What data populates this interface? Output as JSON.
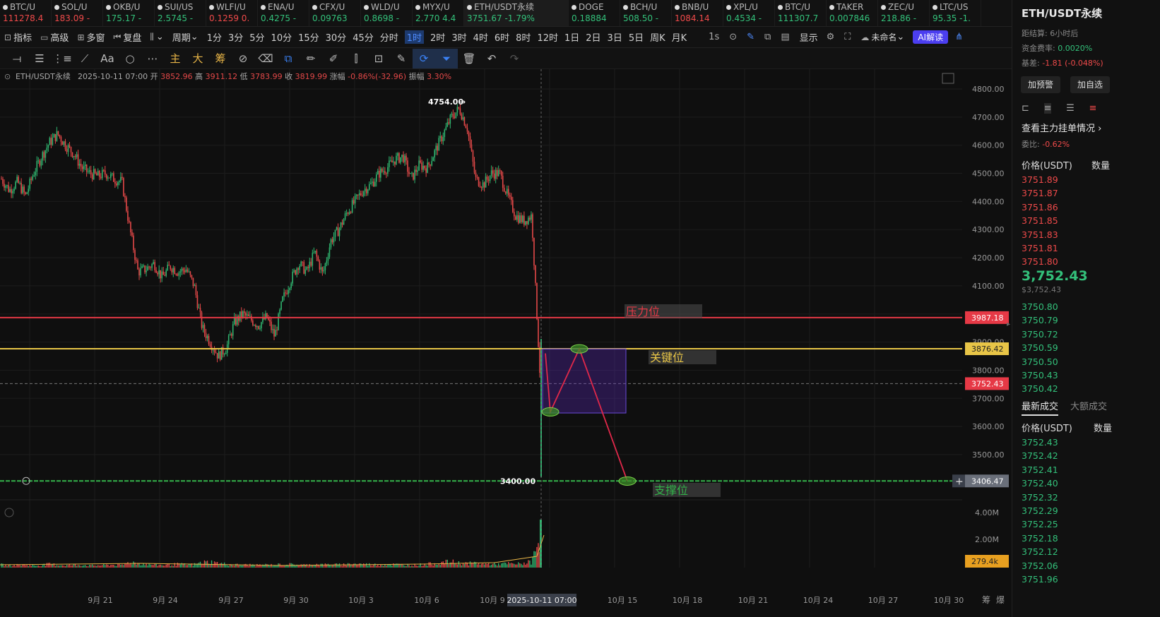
{
  "tickers": [
    {
      "sym": "BTC/U",
      "price": "111278.4",
      "dir": "down"
    },
    {
      "sym": "SOL/U",
      "price": "183.09 -",
      "dir": "down"
    },
    {
      "sym": "OKB/U",
      "price": "175.17 -",
      "dir": "up"
    },
    {
      "sym": "SUI/US",
      "price": "2.5745 -",
      "dir": "up"
    },
    {
      "sym": "WLFI/U",
      "price": "0.1259 0.",
      "dir": "down"
    },
    {
      "sym": "ENA/U",
      "price": "0.4275 -",
      "dir": "up"
    },
    {
      "sym": "CFX/U",
      "price": "0.09763",
      "dir": "up"
    },
    {
      "sym": "WLD/U",
      "price": "0.8698 -",
      "dir": "up"
    },
    {
      "sym": "MYX/U",
      "price": "2.770 4.4",
      "dir": "up"
    },
    {
      "sym": "ETH/USDT永续",
      "price": "3751.67 -1.79%",
      "dir": "up",
      "active": true
    },
    {
      "sym": "DOGE",
      "price": "0.18884",
      "dir": "up"
    },
    {
      "sym": "BCH/U",
      "price": "508.50 -",
      "dir": "up"
    },
    {
      "sym": "BNB/U",
      "price": "1084.14",
      "dir": "down"
    },
    {
      "sym": "XPL/U",
      "price": "0.4534 -",
      "dir": "up"
    },
    {
      "sym": "BTC/U",
      "price": "111307.7",
      "dir": "up"
    },
    {
      "sym": "TAKER",
      "price": "0.007846",
      "dir": "up"
    },
    {
      "sym": "ZEC/U",
      "price": "218.86 -",
      "dir": "up"
    },
    {
      "sym": "LTC/US",
      "price": "95.35 -1.",
      "dir": "up"
    }
  ],
  "ticker_add": "+",
  "menu": {
    "indicators": "指标",
    "advanced": "高级",
    "multi": "多窗",
    "replay": "复盘",
    "period": "周期",
    "timeframes": [
      "1分",
      "3分",
      "5分",
      "10分",
      "15分",
      "30分",
      "45分",
      "分时",
      "1时",
      "2时",
      "3时",
      "4时",
      "6时",
      "8时",
      "12时",
      "1日",
      "2日",
      "3日",
      "5日",
      "周K",
      "月K"
    ],
    "selected_tf": "1时",
    "sec": "1s",
    "display": "显示",
    "unnamed": "未命名",
    "ai": "AI解读"
  },
  "drawbar": {
    "text_tool": "Aa",
    "label_main": "主",
    "label_big": "大",
    "label_chip": "筹"
  },
  "legend": {
    "symbol": "ETH/USDT永续",
    "date": "2025-10-11 07:00",
    "open_l": "开",
    "open": "3852.96",
    "high_l": "高",
    "high": "3911.12",
    "low_l": "低",
    "low": "3783.99",
    "close_l": "收",
    "close": "3819.99",
    "chg_l": "涨幅",
    "chg": "-0.86%(-32.96)",
    "amp_l": "振幅",
    "amp": "3.30%"
  },
  "annotations": {
    "resistance": "压力位",
    "key": "关键位",
    "support": "支撑位",
    "high_marker": "4754.00",
    "low_marker": "3400.00"
  },
  "levels": {
    "resistance": 3987.18,
    "key": 3876.42,
    "current": 3752.43,
    "support": 3406.47
  },
  "level_labels": {
    "resistance": "3987.18",
    "key": "3876.42",
    "current": "3752.43",
    "support": "3406.47",
    "volume": "279.4k"
  },
  "price_axis": [
    "4800.00",
    "4700.00",
    "4600.00",
    "4500.00",
    "4400.00",
    "4300.00",
    "4200.00",
    "4100.00",
    "4000.00",
    "3900.00",
    "3800.00",
    "3700.00",
    "3600.00",
    "3500.00"
  ],
  "volume_axis": [
    "4.00M",
    "2.00M"
  ],
  "date_axis": [
    "9月 21",
    "9月 24",
    "9月 27",
    "9月 30",
    "10月 3",
    "10月 6",
    "10月 9",
    "10月 15",
    "10月 18",
    "10月 21",
    "10月 24",
    "10月 27",
    "10月 30"
  ],
  "crosshair_date": "2025-10-11 07:00",
  "corner": {
    "chip": "筹",
    "burst": "爆"
  },
  "chart_data": {
    "type": "candlestick",
    "y_range": [
      3330,
      4850
    ],
    "price_path": [
      4480,
      4440,
      4470,
      4420,
      4500,
      4560,
      4610,
      4640,
      4600,
      4570,
      4520,
      4500,
      4490,
      4500,
      4480,
      4470,
      4300,
      4150,
      4160,
      4180,
      4130,
      4170,
      4150,
      4160,
      4100,
      3950,
      3900,
      3850,
      3880,
      3970,
      4000,
      3980,
      3960,
      3990,
      3920,
      4050,
      4120,
      4180,
      4150,
      4220,
      4140,
      4260,
      4300,
      4360,
      4400,
      4440,
      4460,
      4500,
      4520,
      4550,
      4560,
      4480,
      4530,
      4520,
      4580,
      4640,
      4700,
      4730,
      4660,
      4480,
      4460,
      4500,
      4500,
      4420,
      4350,
      4330,
      4350,
      3800
    ],
    "vol_path": [
      0.1,
      0.08,
      0.09,
      0.1,
      0.07,
      0.09,
      0.12,
      0.1,
      0.08,
      0.09,
      0.1,
      0.07,
      0.08,
      0.09,
      0.1,
      0.08,
      0.2,
      0.15,
      0.12,
      0.1,
      0.09,
      0.1,
      0.12,
      0.1,
      0.11,
      0.18,
      0.2,
      0.15,
      0.12,
      0.1,
      0.09,
      0.1,
      0.08,
      0.1,
      0.09,
      0.12,
      0.11,
      0.1,
      0.09,
      0.12,
      0.1,
      0.11,
      0.1,
      0.12,
      0.13,
      0.12,
      0.11,
      0.1,
      0.12,
      0.11,
      0.1,
      0.09,
      0.1,
      0.12,
      0.15,
      0.18,
      0.2,
      0.16,
      0.14,
      0.16,
      0.12,
      0.13,
      0.12,
      0.14,
      0.12,
      0.15,
      0.2,
      1.0
    ],
    "drawing_points": [
      [
        3876,
        "box-top"
      ],
      [
        3660,
        "low"
      ],
      [
        3876,
        "key"
      ],
      [
        3406,
        "support"
      ]
    ]
  },
  "right": {
    "title": "ETH/USDT永续",
    "settle_l": "距结算:",
    "settle": "6小时后",
    "funding_l": "资金费率:",
    "funding": "0.0020%",
    "basis_l": "基差:",
    "basis": "-1.81 (-0.048%)",
    "alert_btn": "加预警",
    "fav_btn": "加自选",
    "depth_title": "查看主力挂单情况",
    "ratio_l": "委比:",
    "ratio": "-0.62%",
    "col_price": "价格(USDT)",
    "col_qty": "数量",
    "asks": [
      "3751.89",
      "3751.87",
      "3751.86",
      "3751.85",
      "3751.83",
      "3751.81",
      "3751.80"
    ],
    "last": "3,752.43",
    "last_sub": "$3,752.43",
    "bids": [
      "3750.80",
      "3750.79",
      "3750.72",
      "3750.59",
      "3750.50",
      "3750.43",
      "3750.42"
    ],
    "trades_tab": "最新成交",
    "big_tab": "大额成交",
    "trades": [
      "3752.43",
      "3752.42",
      "3752.41",
      "3752.40",
      "3752.32",
      "3752.29",
      "3752.25",
      "3752.18",
      "3752.12",
      "3752.06",
      "3751.96"
    ]
  }
}
